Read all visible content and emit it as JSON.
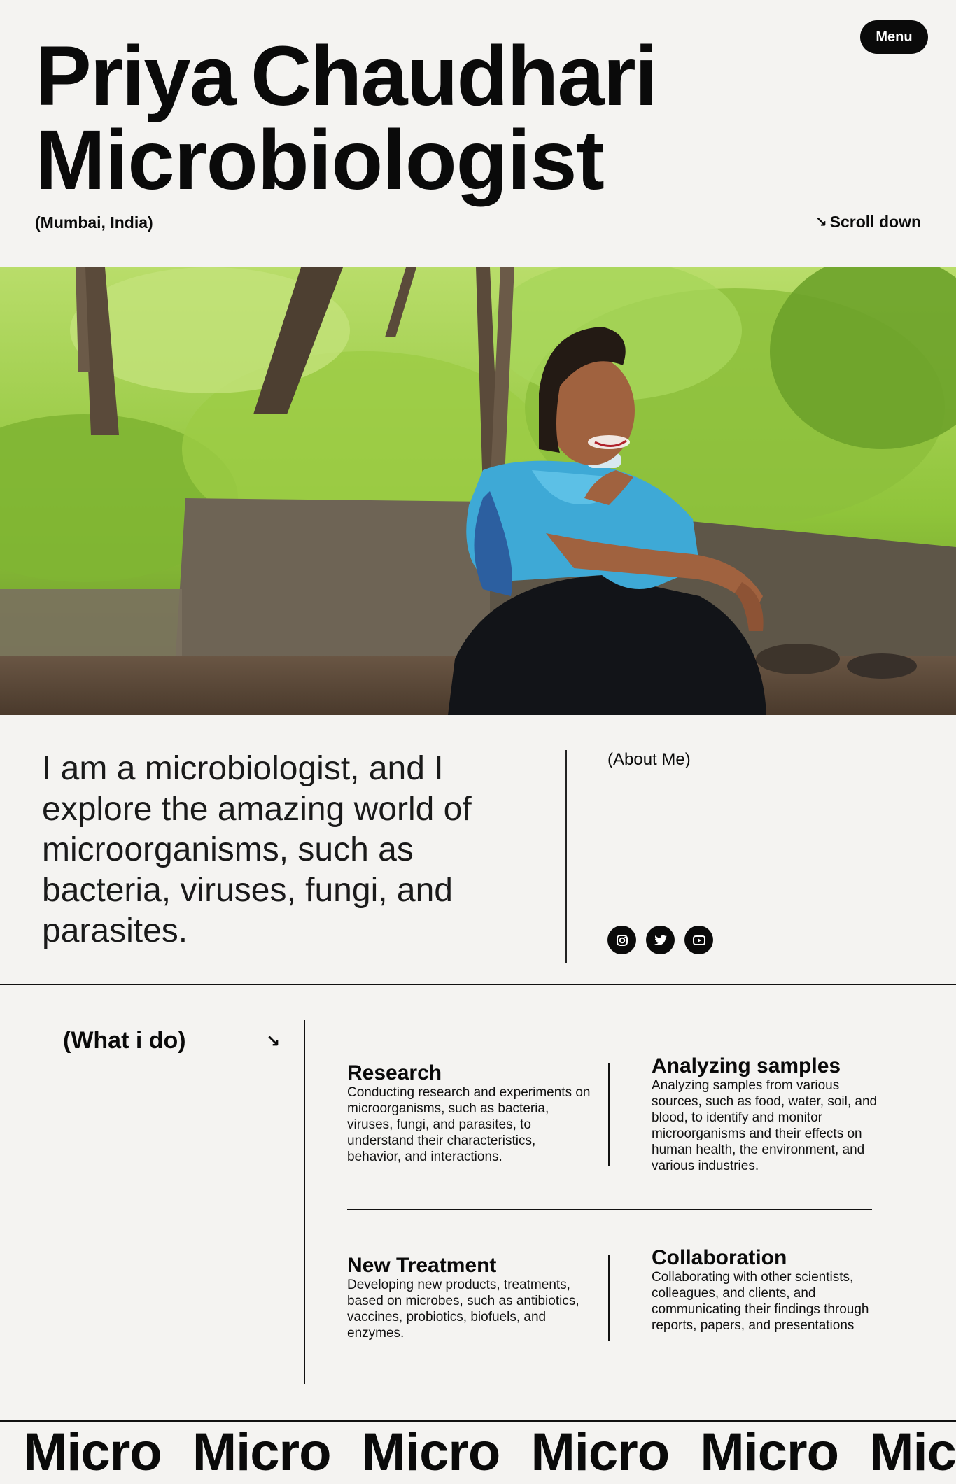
{
  "header": {
    "first_name": "Priya",
    "last_name": "Chaudhari",
    "role": "Microbiologist",
    "location": "(Mumbai, India)",
    "scroll_arrow": "↘",
    "scroll_label": "Scroll down",
    "menu_label": "Menu"
  },
  "hero": {
    "colors": {
      "foliage": "#8fc43a",
      "trunk": "#5a4a3a",
      "wall": "#6e6455",
      "ground": "#5c4a3a",
      "top": "#b9dd6a",
      "blouse": "#3ea9d6",
      "pants": "#121418",
      "skin": "#a0623f"
    }
  },
  "about": {
    "text": "I am a microbiologist, and I explore the amazing world of microorganisms, such as bacteria, viruses, fungi, and parasites.",
    "label": "(About Me)",
    "socials": [
      {
        "icon": "instagram-icon"
      },
      {
        "icon": "twitter-icon"
      },
      {
        "icon": "youtube-icon"
      }
    ]
  },
  "services": {
    "label": "(What i do)",
    "arrow": "↘",
    "items": [
      {
        "title": "Research",
        "description": "Conducting research and experiments on microorganisms, such as bacteria, viruses, fungi, and parasites, to understand their characteristics, behavior, and interactions."
      },
      {
        "title": "Analyzing samples",
        "description": "Analyzing samples from various sources, such as food, water, soil, and blood, to identify and monitor microorganisms and their effects on human health, the environment, and various industries."
      },
      {
        "title": "New Treatment",
        "description": "Developing new products, treatments, based on microbes, such as antibiotics, vaccines, probiotics, biofuels, and enzymes."
      },
      {
        "title": "Collaboration",
        "description": "Collaborating with other scientists, colleagues, and clients, and communicating their findings through reports, papers, and presentations"
      }
    ]
  },
  "marquee": {
    "words": [
      "Micro",
      "Micro",
      "Micro",
      "Micro",
      "Micro",
      "Micro"
    ]
  }
}
